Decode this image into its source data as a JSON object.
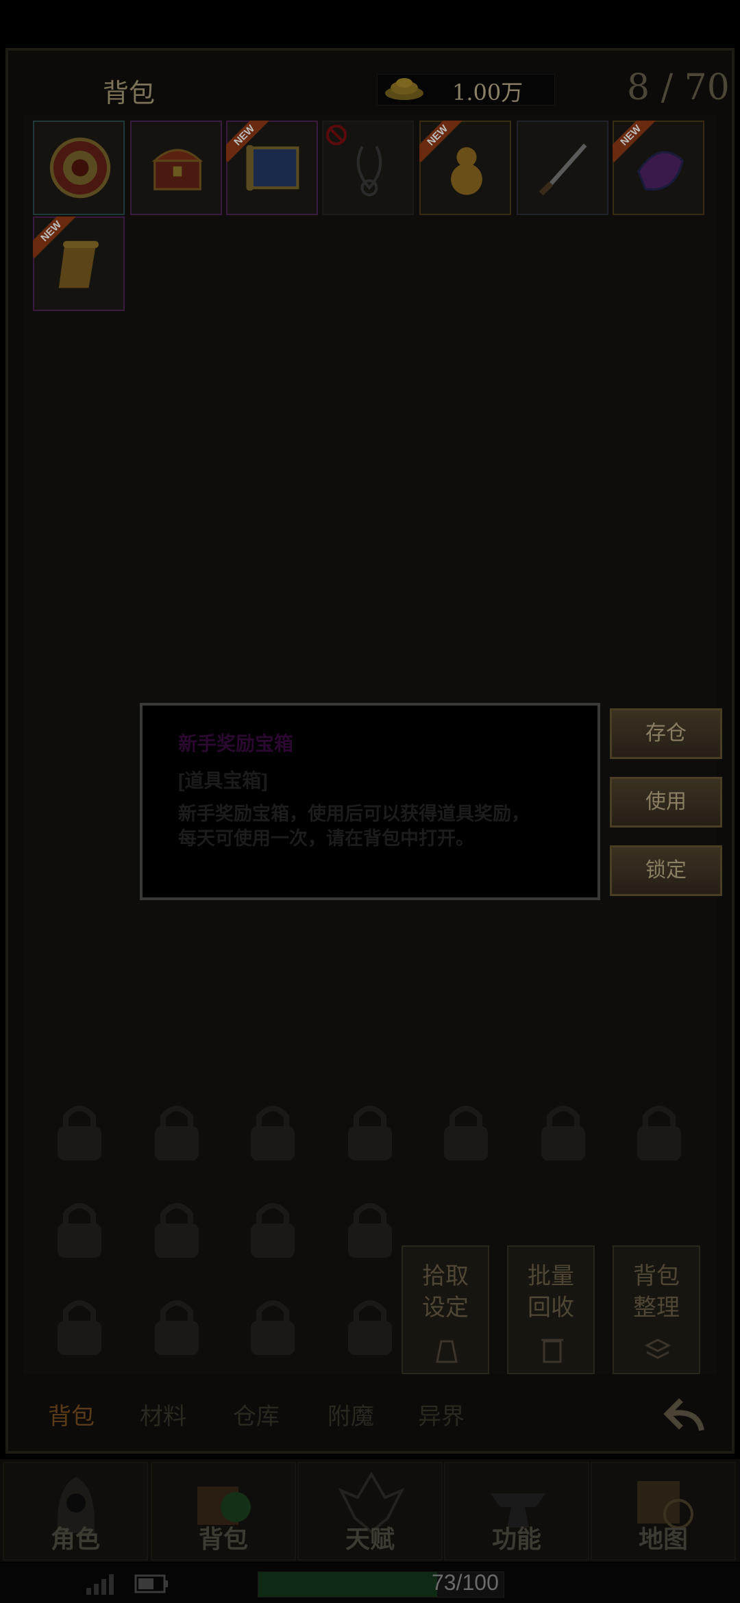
{
  "header": {
    "title": "背包",
    "coins": "1.00万",
    "capacity": "8 / 70"
  },
  "items": [
    {
      "name": "medallion",
      "rarity_color": "#2a6a68",
      "new": false
    },
    {
      "name": "treasure-chest",
      "rarity_color": "#6a2a7a",
      "new": false
    },
    {
      "name": "scroll-map",
      "rarity_color": "#6a2a7a",
      "new": true
    },
    {
      "name": "necklace",
      "rarity_color": "#1a1a1a",
      "new": false,
      "forbidden": true
    },
    {
      "name": "gourd",
      "rarity_color": "#7a5a20",
      "new": true
    },
    {
      "name": "dagger",
      "rarity_color": "#3a3a4a",
      "new": false
    },
    {
      "name": "gem",
      "rarity_color": "#7a5a20",
      "new": true
    },
    {
      "name": "scroll",
      "rarity_color": "#6a2a7a",
      "new": true
    }
  ],
  "new_tag": "NEW",
  "popup": {
    "title": "新手奖励宝箱",
    "type": "[道具宝箱]",
    "description": "新手奖励宝箱，使用后可以获得道具奖励，每天可使用一次，请在背包中打开。"
  },
  "side_buttons": [
    "存仓",
    "使用",
    "锁定"
  ],
  "action_buttons": [
    {
      "line1": "拾取",
      "line2": "设定"
    },
    {
      "line1": "批量",
      "line2": "回收"
    },
    {
      "line1": "背包",
      "line2": "整理"
    }
  ],
  "tabs": [
    "背包",
    "材料",
    "仓库",
    "附魔",
    "异界"
  ],
  "nav": [
    "角色",
    "背包",
    "天赋",
    "功能",
    "地图"
  ],
  "status": {
    "hp_text": "73/100",
    "hp_fraction": 0.73
  },
  "colors": {
    "frame": "#1e1b14",
    "gold_text": "#8b7f63",
    "hp_fill": "#0e2a14"
  }
}
